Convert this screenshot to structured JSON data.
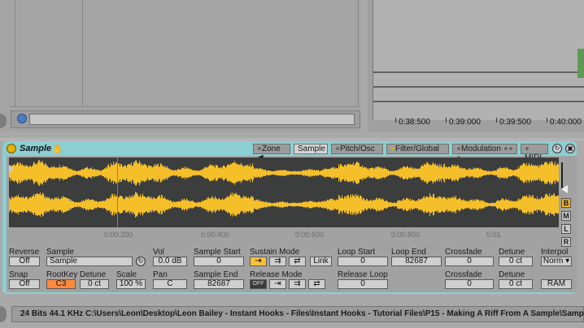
{
  "colors": {
    "device_frame": "#8ccfd3",
    "waveform": "#f5bf2a",
    "waveform_bg": "#3c3d3d",
    "playhead": "#d9632e",
    "accent_yellow": "#f6c23a",
    "accent_orange": "#ff8a3c"
  },
  "timeline": {
    "ticks": [
      "0:38:500",
      "0:39:000",
      "0:39:500",
      "0:40:000"
    ]
  },
  "device": {
    "title": "Sample",
    "hand_icon": "hand-icon",
    "tabs": {
      "zone": "Zone",
      "sample": "Sample",
      "pitch": "Pitch/Osc",
      "filter": "Filter/Global",
      "modulation": "Modulation",
      "midi": "MIDI"
    },
    "side_buttons": [
      "B",
      "M",
      "L",
      "R"
    ],
    "ruler": [
      "0:00:200",
      "0:00:400",
      "0:00:600",
      "0:00:800",
      "0:01"
    ]
  },
  "controls": {
    "reverse": {
      "label": "Reverse",
      "value": "Off"
    },
    "sample": {
      "label": "Sample",
      "value": "Sample"
    },
    "vol": {
      "label": "Vol",
      "value": "0.0 dB"
    },
    "sample_start": {
      "label": "Sample Start",
      "value": "0"
    },
    "sustain_mode": {
      "label": "Sustain Mode",
      "link": "Link"
    },
    "loop_start": {
      "label": "Loop Start",
      "value": "0"
    },
    "loop_end": {
      "label": "Loop End",
      "value": "82687"
    },
    "crossfade": {
      "label": "Crossfade",
      "value": "0"
    },
    "detune": {
      "label": "Detune",
      "value": "0 ct"
    },
    "interpol": {
      "label": "Interpol",
      "value": "Norm"
    },
    "snap": {
      "label": "Snap",
      "value": "Off"
    },
    "rootkey": {
      "label": "RootKey",
      "value": "C3"
    },
    "detune2": {
      "label": "Detune",
      "value": "0 ct"
    },
    "scale": {
      "label": "Scale",
      "value": "100 %"
    },
    "pan": {
      "label": "Pan",
      "value": "C"
    },
    "sample_end": {
      "label": "Sample End",
      "value": "82687"
    },
    "release_mode": {
      "label": "Release Mode",
      "off": "OFF"
    },
    "release_loop": {
      "label": "Release Loop",
      "value": "0"
    },
    "crossfade2": {
      "label": "Crossfade",
      "value": "0"
    },
    "detune3": {
      "label": "Detune",
      "value": "0 ct"
    },
    "ram": "RAM"
  },
  "status": {
    "text": "24 Bits 44.1 KHz C:\\Users\\Leon\\Desktop\\Leon Bailey - Instant Hooks - Files\\Instant Hooks - Tutorial Files\\P15 - Making A Riff From A Sample\\Sample.wa"
  }
}
